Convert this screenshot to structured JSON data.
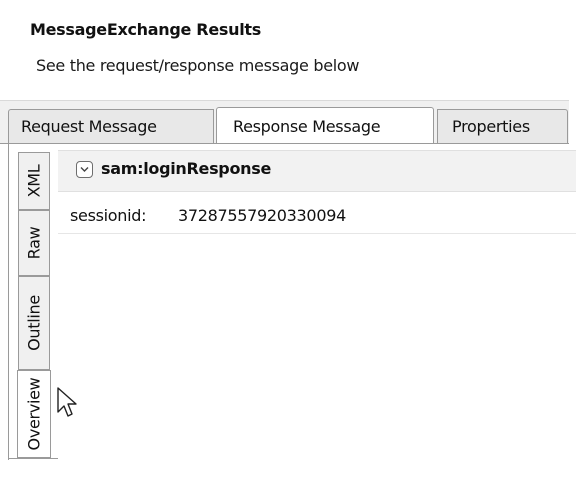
{
  "header": {
    "title": "MessageExchange Results",
    "subtitle": "See the request/response message below"
  },
  "tabs": [
    {
      "label": "Request Message",
      "active": false
    },
    {
      "label": "Response Message",
      "active": true
    },
    {
      "label": "Properties",
      "active": false
    }
  ],
  "view_tabs": [
    {
      "label": "XML",
      "active": false
    },
    {
      "label": "Raw",
      "active": false
    },
    {
      "label": "Outline",
      "active": false
    },
    {
      "label": "Overview",
      "active": true
    }
  ],
  "tree": {
    "node_label": "sam:loginResponse",
    "toggle_icon": "collapse-icon",
    "fields": [
      {
        "name": "sessionid:",
        "value": "37287557920330094"
      }
    ]
  },
  "colors": {
    "tab_border": "#9a9a9a",
    "tab_bg": "#e8e8e8",
    "active_bg": "#ffffff",
    "tree_header_bg": "#f2f2f2"
  }
}
